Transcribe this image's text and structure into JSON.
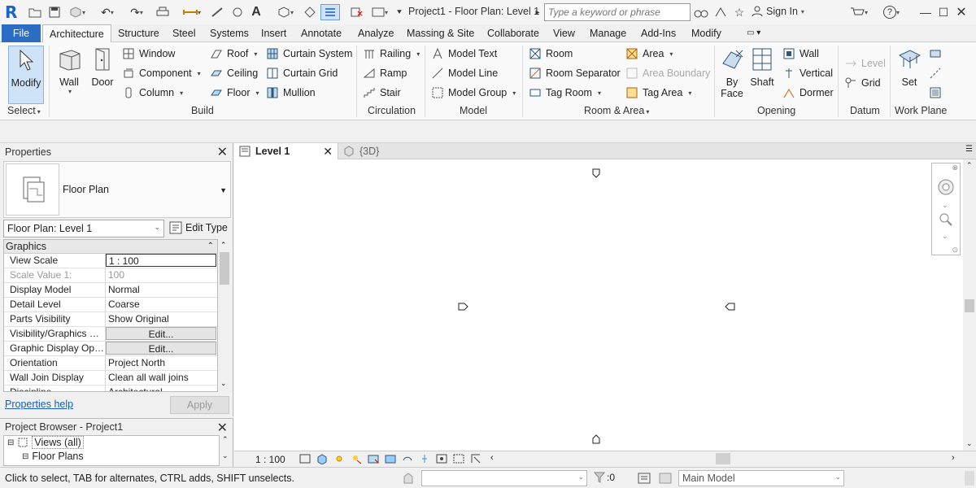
{
  "titlebar": {
    "app_logo": "R",
    "title": "Project1 - Floor Plan: Level 1",
    "search_placeholder": "Type a keyword or phrase",
    "signin_label": "Sign In",
    "help_label": "?"
  },
  "tabs": [
    "File",
    "Architecture",
    "Structure",
    "Steel",
    "Systems",
    "Insert",
    "Annotate",
    "Analyze",
    "Massing & Site",
    "Collaborate",
    "View",
    "Manage",
    "Add-Ins",
    "Modify"
  ],
  "ribbon": {
    "select": {
      "modify_label": "Modify",
      "panel_title": "Select"
    },
    "build": {
      "wall": "Wall",
      "door": "Door",
      "window": "Window",
      "component": "Component",
      "column": "Column",
      "roof": "Roof",
      "ceiling": "Ceiling",
      "floor": "Floor",
      "curtain_system": "Curtain System",
      "curtain_grid": "Curtain Grid",
      "mullion": "Mullion",
      "panel_title": "Build"
    },
    "circulation": {
      "railing": "Railing",
      "ramp": "Ramp",
      "stair": "Stair",
      "panel_title": "Circulation"
    },
    "model": {
      "model_text": "Model Text",
      "model_line": "Model Line",
      "model_group": "Model Group",
      "panel_title": "Model"
    },
    "room_area": {
      "room": "Room",
      "room_separator": "Room Separator",
      "tag_room": "Tag Room",
      "area": "Area",
      "area_boundary": "Area Boundary",
      "tag_area": "Tag Area",
      "panel_title": "Room & Area"
    },
    "opening": {
      "by_face": "By\nFace",
      "shaft": "Shaft",
      "wall": "Wall",
      "vertical": "Vertical",
      "dormer": "Dormer",
      "panel_title": "Opening"
    },
    "datum": {
      "level": "Level",
      "grid": "Grid",
      "panel_title": "Datum"
    },
    "workplane": {
      "set": "Set",
      "panel_title": "Work Plane"
    }
  },
  "properties": {
    "title": "Properties",
    "type_name": "Floor Plan",
    "instance_selector": "Floor Plan: Level 1",
    "edit_type_label": "Edit Type",
    "group_header": "Graphics",
    "rows": [
      {
        "key": "View Scale",
        "value": "1 : 100",
        "kind": "input"
      },
      {
        "key": "Scale Value    1:",
        "value": "100",
        "kind": "disabled"
      },
      {
        "key": "Display Model",
        "value": "Normal",
        "kind": "text"
      },
      {
        "key": "Detail Level",
        "value": "Coarse",
        "kind": "text"
      },
      {
        "key": "Parts Visibility",
        "value": "Show Original",
        "kind": "text"
      },
      {
        "key": "Visibility/Graphics O...",
        "value": "Edit...",
        "kind": "button"
      },
      {
        "key": "Graphic Display Opti...",
        "value": "Edit...",
        "kind": "button"
      },
      {
        "key": "Orientation",
        "value": "Project North",
        "kind": "text"
      },
      {
        "key": "Wall Join Display",
        "value": "Clean all wall joins",
        "kind": "text"
      },
      {
        "key": "Discipline",
        "value": "Architectural",
        "kind": "text"
      }
    ],
    "help_link": "Properties help",
    "apply_label": "Apply"
  },
  "browser": {
    "title": "Project Browser - Project1",
    "views_label": "Views (all)",
    "floor_plans_label": "Floor Plans"
  },
  "viewtabs": [
    {
      "label": "Level 1",
      "active": true
    },
    {
      "label": "{3D}",
      "active": false
    }
  ],
  "viewcontrol": {
    "scale": "1 : 100"
  },
  "status": {
    "message": "Click to select, TAB for alternates, CTRL adds, SHIFT unselects.",
    "filter_count": ":0",
    "model_selector": "Main Model"
  },
  "colors": {
    "accent": "#2b6cc4",
    "modify_bg": "#cfe3f8"
  }
}
